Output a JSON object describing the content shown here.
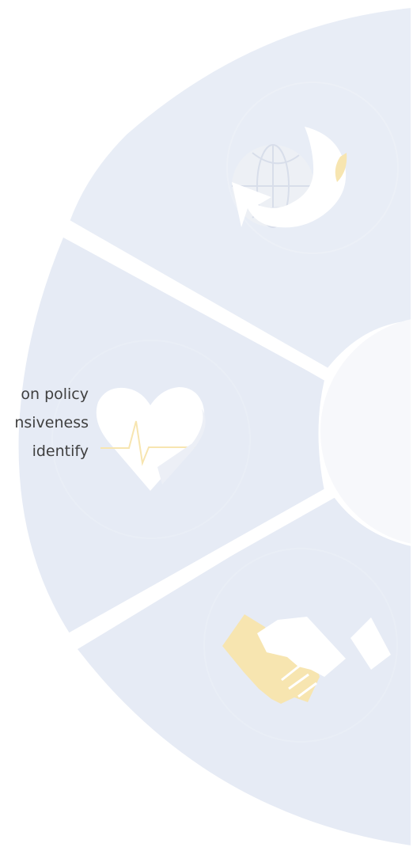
{
  "text_lines": [
    "on policy",
    "nsiveness",
    "identify"
  ],
  "colors": {
    "segment_top": "#e8edf6",
    "segment_middle": "#e6ebf5",
    "segment_bottom": "#e6ebf5",
    "center": "#f7f8fb",
    "divider": "#ffffff",
    "icon_white": "#ffffff",
    "icon_gold": "#f7e5b0",
    "icon_globe": "#edf0f5",
    "text": "#3f3f3f"
  },
  "icons": [
    "globe-refresh-icon",
    "heart-pulse-icon",
    "handshake-icon"
  ]
}
